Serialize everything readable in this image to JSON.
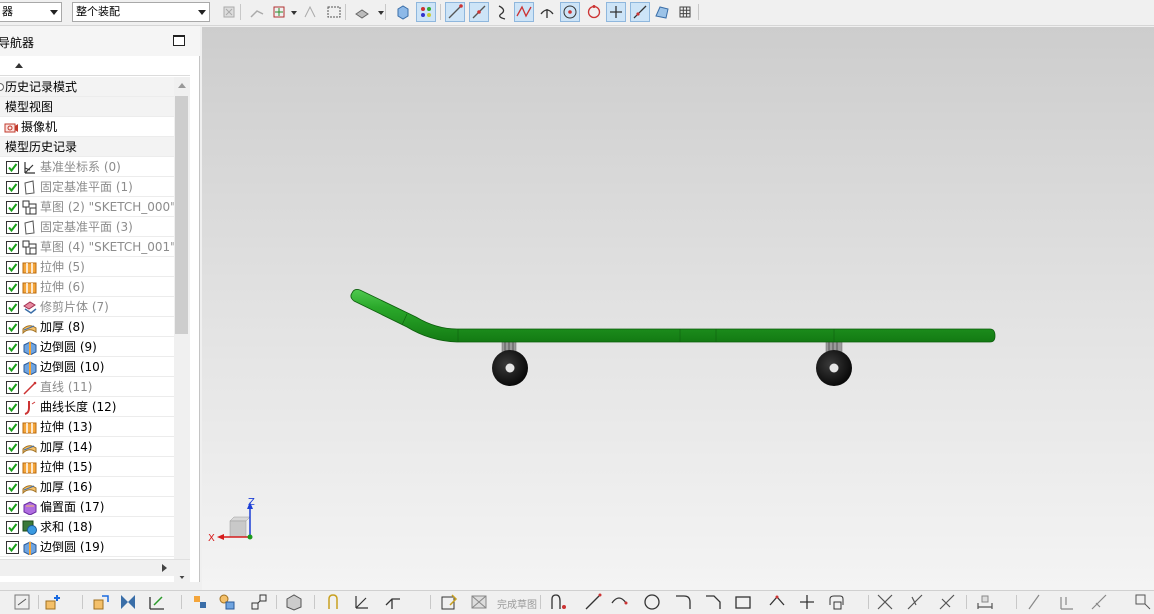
{
  "toolbar": {
    "filter_value": "器",
    "scope_value": "整个装配",
    "buttons": [
      {
        "name": "deselect-icon",
        "on": false
      },
      {
        "name": "snap-icon",
        "on": false
      },
      {
        "name": "select-body-icon",
        "on": false
      },
      {
        "name": "point-cross-icon",
        "on": false
      },
      {
        "name": "select-rect-icon",
        "on": false
      },
      {
        "name": "solid-shade-icon",
        "on": false
      },
      {
        "name": "cube-icon",
        "on": false
      },
      {
        "name": "snap-all-icon",
        "on": true
      },
      {
        "name": "end-point-icon",
        "on": true
      },
      {
        "name": "mid-point-icon",
        "on": true
      },
      {
        "name": "control-point-icon",
        "on": false
      },
      {
        "name": "intersect-point-icon",
        "on": true
      },
      {
        "name": "arc-center-icon",
        "on": false
      },
      {
        "name": "circle-center-icon",
        "on": true
      },
      {
        "name": "quadrant-point-icon",
        "on": false
      },
      {
        "name": "existing-point-icon",
        "on": true
      },
      {
        "name": "point-on-curve-icon",
        "on": true
      },
      {
        "name": "point-on-face-icon",
        "on": false
      },
      {
        "name": "grid-icon",
        "on": false
      }
    ]
  },
  "navigator": {
    "title": "导航器",
    "groups": [
      {
        "label": "历史记录模式"
      },
      {
        "label": "模型视图"
      },
      {
        "label": "摄像机"
      },
      {
        "label": "模型历史记录"
      }
    ],
    "features": [
      {
        "label": "基准坐标系 (0)",
        "icon": "datum-csys-icon",
        "dim": true
      },
      {
        "label": "固定基准平面 (1)",
        "icon": "datum-plane-icon",
        "dim": true
      },
      {
        "label": "草图 (2) \"SKETCH_000\"",
        "icon": "sketch-icon",
        "dim": true
      },
      {
        "label": "固定基准平面 (3)",
        "icon": "datum-plane-icon",
        "dim": true
      },
      {
        "label": "草图 (4) \"SKETCH_001\"",
        "icon": "sketch-icon",
        "dim": true
      },
      {
        "label": "拉伸 (5)",
        "icon": "extrude-icon",
        "dim": true
      },
      {
        "label": "拉伸 (6)",
        "icon": "extrude-icon",
        "dim": true
      },
      {
        "label": "修剪片体 (7)",
        "icon": "trim-sheet-icon",
        "dim": true
      },
      {
        "label": "加厚 (8)",
        "icon": "thicken-icon",
        "dim": false
      },
      {
        "label": "边倒圆 (9)",
        "icon": "edge-blend-icon",
        "dim": false
      },
      {
        "label": "边倒圆 (10)",
        "icon": "edge-blend-icon",
        "dim": false
      },
      {
        "label": "直线 (11)",
        "icon": "line-icon",
        "dim": true
      },
      {
        "label": "曲线长度 (12)",
        "icon": "curve-length-icon",
        "dim": false
      },
      {
        "label": "拉伸 (13)",
        "icon": "extrude-icon",
        "dim": false
      },
      {
        "label": "加厚 (14)",
        "icon": "thicken-icon",
        "dim": false
      },
      {
        "label": "拉伸 (15)",
        "icon": "extrude-icon",
        "dim": false
      },
      {
        "label": "加厚 (16)",
        "icon": "thicken-icon",
        "dim": false
      },
      {
        "label": "偏置面 (17)",
        "icon": "offset-face-icon",
        "dim": false
      },
      {
        "label": "求和 (18)",
        "icon": "unite-icon",
        "dim": false
      },
      {
        "label": "边倒圆 (19)",
        "icon": "edge-blend-icon",
        "dim": false
      }
    ]
  },
  "viewport": {
    "axis_x": "X",
    "axis_z": "Z",
    "model_color": "#1f9a1f",
    "wheel_color": "#1a1a1a"
  },
  "bottombar": {
    "finish_sketch_label": "完成草图"
  }
}
